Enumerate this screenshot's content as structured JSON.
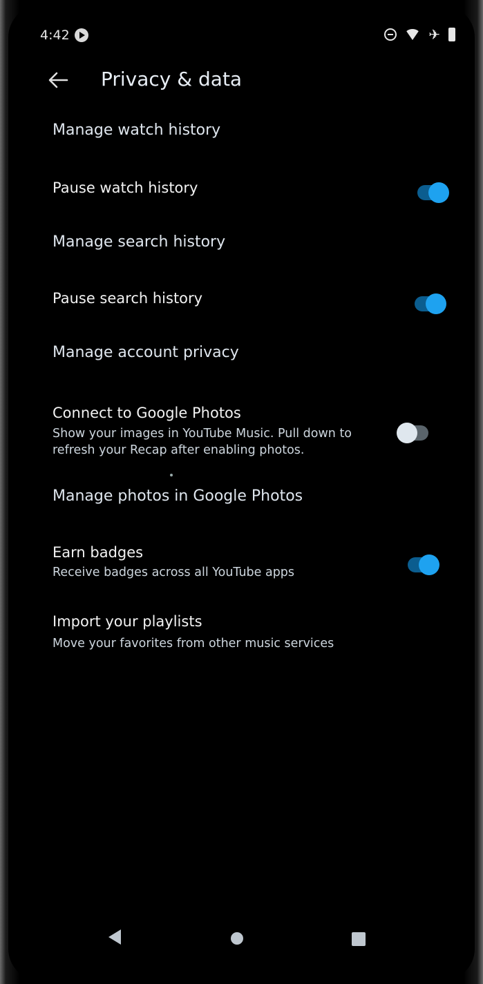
{
  "status_bar": {
    "time": "4:42"
  },
  "header": {
    "title": "Privacy & data"
  },
  "sections": {
    "watch_history": {
      "label": "Manage watch history",
      "item": {
        "title": "Pause watch history",
        "toggle": "on"
      }
    },
    "search_history": {
      "label": "Manage search history",
      "item": {
        "title": "Pause search history",
        "toggle": "on"
      }
    },
    "account_privacy": {
      "label": "Manage account privacy",
      "item": {
        "title": "Connect to Google Photos",
        "subtitle_line1": "Show your images in YouTube Music. Pull down to",
        "subtitle_line2": "refresh your Recap after enabling photos.",
        "toggle": "off"
      }
    },
    "google_photos": {
      "label": "Manage photos in Google Photos",
      "item": {
        "title": "Earn badges",
        "subtitle": "Receive badges across all YouTube apps",
        "toggle": "on"
      }
    },
    "import": {
      "title": "Import your playlists",
      "subtitle": "Move your favorites from other music services"
    }
  },
  "colors": {
    "background": "#000000",
    "toggle_on_knob": "#1ea2f0",
    "toggle_on_track": "#0b5d8f",
    "toggle_off_knob": "#dfe7ee",
    "toggle_off_track": "#5a646b"
  }
}
